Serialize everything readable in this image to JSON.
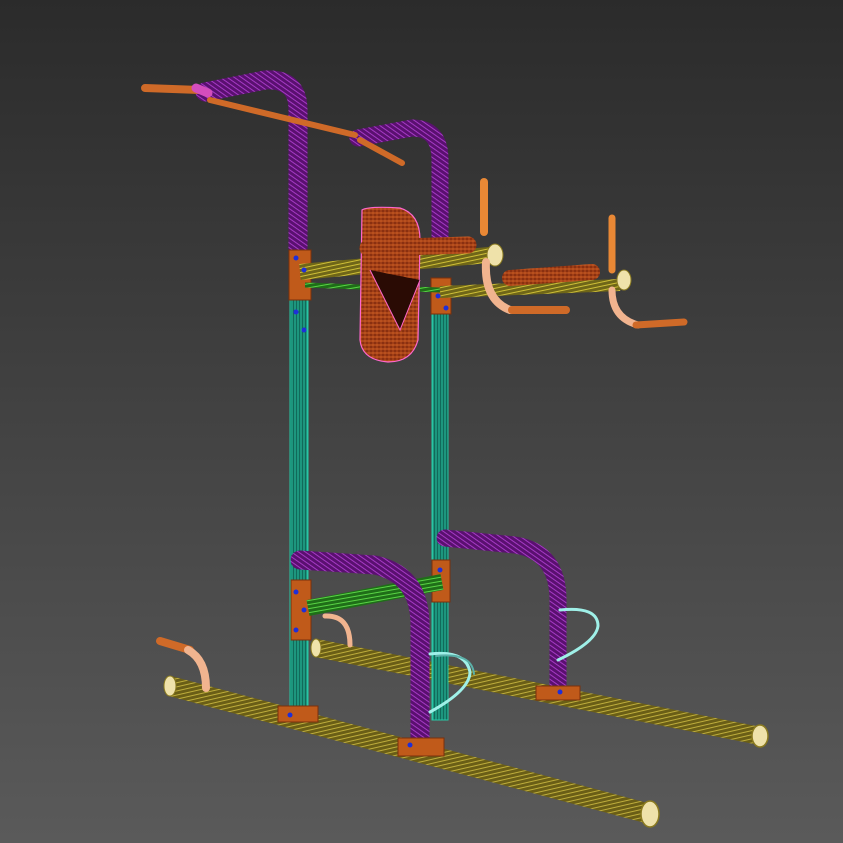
{
  "viewport": {
    "background_top": "#2b2b2b",
    "background_bottom": "#5a5a5a"
  },
  "colors": {
    "pull_up_bar": "#cf6a28",
    "grip_accent": "#d44dbd",
    "upper_arch": "#7b1c92",
    "frame_upright": "#1aa38b",
    "frame_inner": "#27c9a6",
    "crossbar_yellow": "#a89a24",
    "crossbar_green": "#3fb52d",
    "bracket": "#c05a1a",
    "pad": "#b0451a",
    "pad_edge": "#ff66cc",
    "armrest": "#a8441b",
    "grip_handle": "#e98835",
    "handle_curve": "#f1b48f",
    "base_tube": "#9c8c2e",
    "base_cap": "#efe2aa",
    "foot_hook": "#9ff0e8",
    "bolt": "#1f2fd8"
  },
  "object": {
    "icon": "power-tower-wireframe-model"
  }
}
